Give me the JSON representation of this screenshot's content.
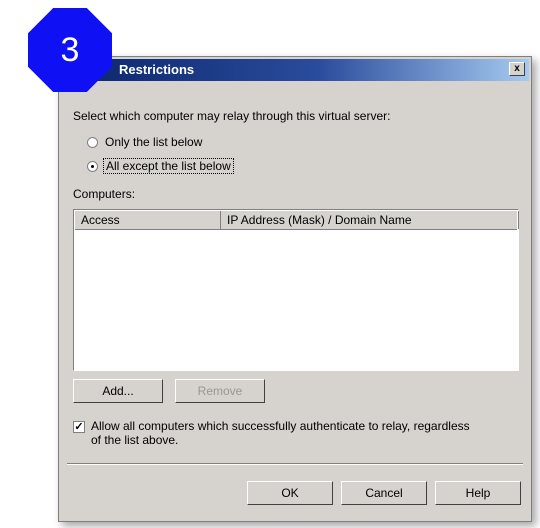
{
  "badge": {
    "number": "3"
  },
  "window": {
    "title": "Restrictions",
    "close_label": "x"
  },
  "prompt": "Select which computer may relay through this virtual server:",
  "options": [
    {
      "label": "Only the list below",
      "selected": false
    },
    {
      "label": "All except the list below",
      "selected": true
    }
  ],
  "computers_label": "Computers:",
  "list": {
    "columns": [
      "Access",
      "IP Address (Mask) / Domain Name"
    ],
    "rows": []
  },
  "buttons": {
    "add": "Add...",
    "remove": "Remove",
    "ok": "OK",
    "cancel": "Cancel",
    "help": "Help"
  },
  "allow_checkbox": {
    "checked": true,
    "line1": "Allow all computers which successfully authenticate to relay, regardless",
    "line2": "of the list above."
  }
}
